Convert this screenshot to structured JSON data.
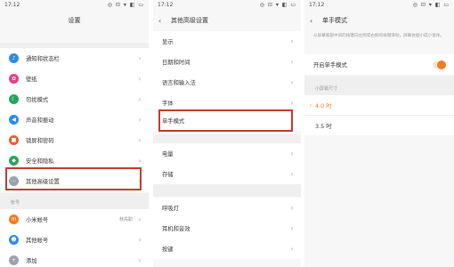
{
  "status": {
    "time": "17:12",
    "icons": "◎ ⊡ ▾ ◧ ▭"
  },
  "panel1": {
    "title": "设置",
    "items": [
      {
        "label": "通知和状态栏",
        "icon": "bell-icon",
        "color": "#2d8be6"
      },
      {
        "label": "壁纸",
        "icon": "wallpaper-icon",
        "color": "#e23f8b"
      },
      {
        "label": "勿扰模式",
        "icon": "dnd-icon",
        "color": "#22a65b"
      },
      {
        "label": "声音和振动",
        "icon": "speaker-icon",
        "color": "#2d8be6"
      },
      {
        "label": "锁屏和密码",
        "icon": "lock-icon",
        "color": "#ef5a2d"
      },
      {
        "label": "安全和隐私",
        "icon": "shield-icon",
        "color": "#2aa45a"
      },
      {
        "label": "其他高级设置",
        "icon": "more-icon",
        "color": "#9aa2ab"
      }
    ],
    "account_section_label": "帐号",
    "account_items": [
      {
        "label": "小米帐号",
        "value": "林先职",
        "icon": "mi-icon",
        "color": "#f47b20"
      },
      {
        "label": "其他帐号",
        "icon": "person-icon",
        "color": "#2d8be6"
      },
      {
        "label": "添加",
        "icon": "add-icon",
        "color": "#9aa2ab"
      }
    ]
  },
  "panel2": {
    "title": "其他高级设置",
    "items": [
      "显示",
      "日期和时间",
      "语言和输入法",
      "字体",
      "单手模式",
      "电量",
      "存储",
      "呼吸灯",
      "耳机和音效",
      "按键"
    ]
  },
  "panel3": {
    "title": "单手模式",
    "description": "从屏幕底部中间的按键向左侧或右侧的按键滑动，屏幕会缩小成小窗体。",
    "toggle_label": "开启单手模式",
    "toggle_on": true,
    "size_section_label": "小屏幕尺寸",
    "options": [
      {
        "label": "4.0 吋",
        "selected": true
      },
      {
        "label": "3.5 吋",
        "selected": false
      }
    ],
    "accent": "#f47b20"
  },
  "highlight_color": "#c33a2d"
}
